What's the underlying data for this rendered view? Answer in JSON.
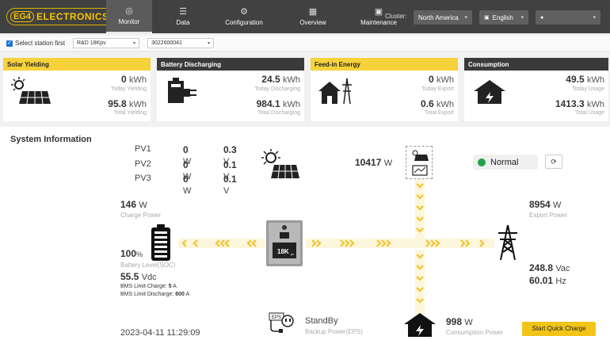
{
  "brand": {
    "logo_mark": "EG4",
    "logo_text": "ELECTRONICS"
  },
  "nav": [
    {
      "label": "Monitor",
      "icon": "◎"
    },
    {
      "label": "Data",
      "icon": "☰"
    },
    {
      "label": "Configuration",
      "icon": "⚙"
    },
    {
      "label": "Overview",
      "icon": "▦"
    },
    {
      "label": "Maintenance",
      "icon": "▣"
    }
  ],
  "header": {
    "cluster_label": "Cluster:",
    "cluster_value": "North America",
    "language_value": "English",
    "user_value": ""
  },
  "station": {
    "checkbox_label": "Select station first",
    "station_value": "R&D 18Kpv",
    "serial_value": "3022600041"
  },
  "cards": {
    "solar": {
      "title": "Solar Yielding",
      "today_value": "0",
      "today_unit": "kWh",
      "today_label": "Today Yielding",
      "total_value": "95.8",
      "total_unit": "kWh",
      "total_label": "Total Yielding"
    },
    "battery": {
      "title": "Battery Discharging",
      "today_value": "24.5",
      "today_unit": "kWh",
      "today_label": "Today Discharging",
      "total_value": "984.1",
      "total_unit": "kWh",
      "total_label": "Total Discharging"
    },
    "feedin": {
      "title": "Feed-in Energy",
      "today_value": "0",
      "today_unit": "kWh",
      "today_label": "Today Export",
      "total_value": "0.6",
      "total_unit": "kWh",
      "total_label": "Total Export"
    },
    "consumption": {
      "title": "Consumption",
      "today_value": "49.5",
      "today_unit": "kWh",
      "today_label": "Today Usage",
      "total_value": "1413.3",
      "total_unit": "kWh",
      "total_label": "Total Usage"
    }
  },
  "system": {
    "title": "System Information",
    "pv": [
      {
        "name": "PV1",
        "power": "0",
        "power_unit": "W",
        "voltage": "0.3",
        "voltage_unit": "V"
      },
      {
        "name": "PV2",
        "power": "0",
        "power_unit": "W",
        "voltage": "0.1",
        "voltage_unit": "V"
      },
      {
        "name": "PV3",
        "power": "0",
        "power_unit": "W",
        "voltage": "0.1",
        "voltage_unit": "V"
      }
    ],
    "solar_power": {
      "value": "10417",
      "unit": "W"
    },
    "status": "Normal",
    "charge_power": {
      "value": "146",
      "unit": "W",
      "label": "Charge Power"
    },
    "export_power": {
      "value": "8954",
      "unit": "W",
      "label": "Export Power"
    },
    "soc": {
      "value": "100",
      "unit": "%",
      "label": "Battery Level(SOC)"
    },
    "battery_voltage": {
      "value": "55.5",
      "unit": "Vdc"
    },
    "bms_charge": {
      "label": "BMS Limit Charge:",
      "value": "5",
      "unit": "A"
    },
    "bms_discharge": {
      "label": "BMS Limit Discharge:",
      "value": "600",
      "unit": "A"
    },
    "grid_voltage": {
      "value": "248.8",
      "unit": "Vac"
    },
    "grid_freq": {
      "value": "60.01",
      "unit": "Hz"
    },
    "inverter_label": "18K",
    "inverter_sub": "pv",
    "eps_status": "StandBy",
    "eps_label": "Backup Power(EPS)",
    "eps_icon_text": "EPS",
    "consumption_power": {
      "value": "998",
      "unit": "W",
      "label": "Consumption Power"
    },
    "timestamp": "2023-04-11 11:29:09",
    "quick_charge_label": "Start Quick Charge"
  },
  "colors": {
    "accent_yellow": "#f6d23b",
    "header_dark": "#414141",
    "card_dark": "#3a3a3a",
    "status_green": "#22a04a",
    "flow_yellow": "#f2c842"
  }
}
